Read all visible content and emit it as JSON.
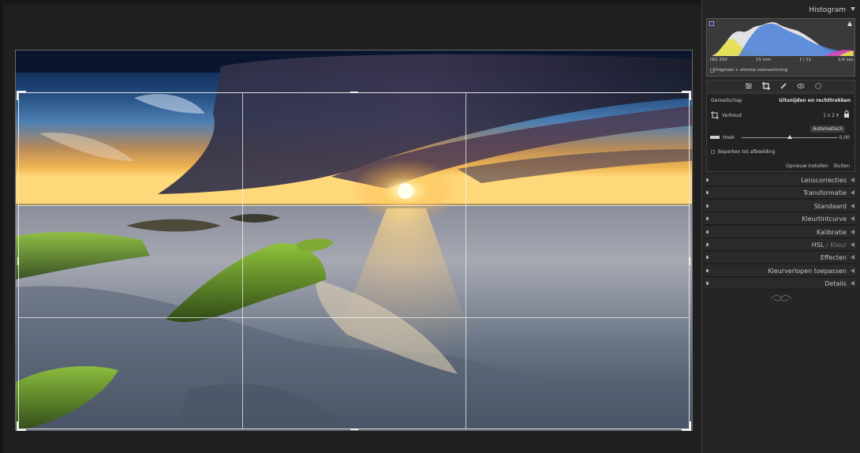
{
  "panel": {
    "histogram": {
      "title": "Histogram",
      "iso": "ISO 200",
      "focal": "15 mm",
      "aperture": "ƒ / 11",
      "shutter": "1/4 sec",
      "original_label": "Origineel + slimme voorvertoning"
    },
    "crop": {
      "tool_label": "Gereedschap",
      "tool_name": "Uitsnijden en rechttrekken",
      "aspect_label": "Verhoud",
      "aspect_value": "1 x 2 ‡",
      "auto_label": "Automatisch",
      "angle_label": "Hoek",
      "angle_value": "0,00",
      "angle_fraction": 0.5,
      "constrain_label": "Beperken tot afbeelding",
      "reset_label": "Opnieuw instellen",
      "close_label": "Sluiten"
    },
    "sections": [
      {
        "label": "Lenscorrecties"
      },
      {
        "label": "Transformatie"
      },
      {
        "label": "Standaard"
      },
      {
        "label": "Kleurtintcurve"
      },
      {
        "label": "Kalibratie"
      },
      {
        "label": "HSL",
        "suffix": " / Kleur"
      },
      {
        "label": "Effecten"
      },
      {
        "label": "Kleurverlopen toepassen"
      },
      {
        "label": "Details"
      }
    ]
  },
  "colors": {
    "accent_sun": "#ffd97a",
    "moss": "#6a9a2a",
    "panel_bg": "#252525"
  }
}
